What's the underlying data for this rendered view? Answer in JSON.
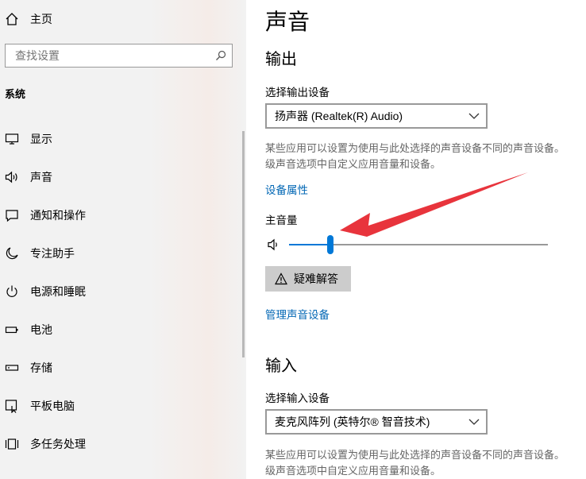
{
  "sidebar": {
    "home_label": "主页",
    "search_placeholder": "查找设置",
    "section_label": "系统",
    "items": [
      {
        "label": "显示",
        "icon": "monitor-icon"
      },
      {
        "label": "声音",
        "icon": "speaker-icon"
      },
      {
        "label": "通知和操作",
        "icon": "notification-icon"
      },
      {
        "label": "专注助手",
        "icon": "moon-icon"
      },
      {
        "label": "电源和睡眠",
        "icon": "power-icon"
      },
      {
        "label": "电池",
        "icon": "battery-icon"
      },
      {
        "label": "存储",
        "icon": "storage-icon"
      },
      {
        "label": "平板电脑",
        "icon": "tablet-icon"
      },
      {
        "label": "多任务处理",
        "icon": "multitask-icon"
      }
    ]
  },
  "main": {
    "title": "声音",
    "output": {
      "heading": "输出",
      "device_label": "选择输出设备",
      "device_value": "扬声器 (Realtek(R) Audio)",
      "description_line1": "某些应用可以设置为使用与此处选择的声音设备不同的声音设备。",
      "description_line2": "级声音选项中自定义应用音量和设备。",
      "properties_link": "设备属性",
      "volume_label": "主音量",
      "volume_fraction": 0.16,
      "troubleshoot_label": "疑难解答",
      "manage_link": "管理声音设备"
    },
    "input": {
      "heading": "输入",
      "device_label": "选择输入设备",
      "device_value": "麦克风阵列 (英特尔® 智音技术)",
      "description_line1": "某些应用可以设置为使用与此处选择的声音设备不同的声音设备。",
      "description_line2": "级声音选项中自定义应用音量和设备。"
    }
  },
  "colors": {
    "accent": "#0078d7",
    "link": "#0066b4",
    "annotation_arrow": "#e8343c"
  }
}
